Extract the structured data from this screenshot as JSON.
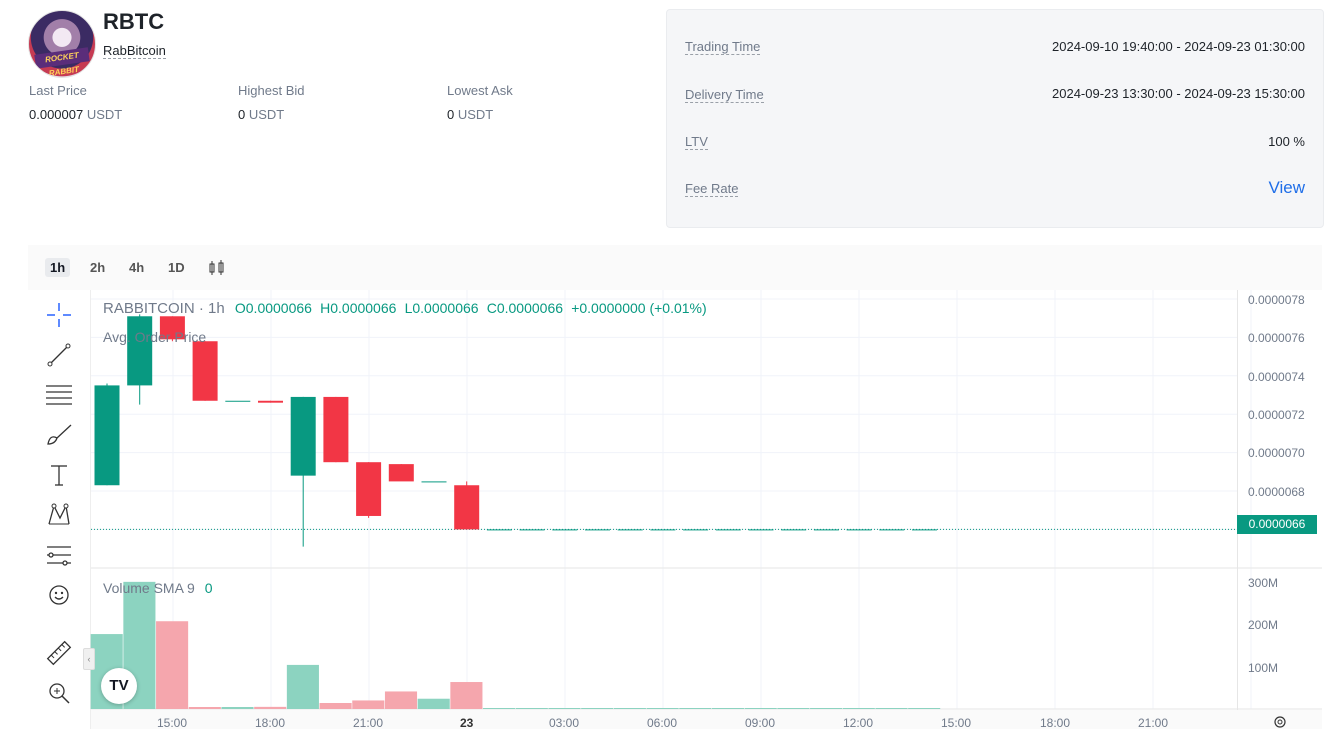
{
  "header": {
    "symbol": "RBTC",
    "name": "RabBitcoin",
    "avatar_text": "ROCKET RABBIT"
  },
  "stats": [
    {
      "label": "Last Price",
      "value": "0.000007",
      "unit": "USDT"
    },
    {
      "label": "Highest Bid",
      "value": "0",
      "unit": "USDT"
    },
    {
      "label": "Lowest Ask",
      "value": "0",
      "unit": "USDT"
    }
  ],
  "info": {
    "trading_time_label": "Trading Time",
    "trading_time_value": "2024-09-10 19:40:00 - 2024-09-23 01:30:00",
    "delivery_time_label": "Delivery Time",
    "delivery_time_value": "2024-09-23 13:30:00 - 2024-09-23 15:30:00",
    "ltv_label": "LTV",
    "ltv_value": "100 %",
    "fee_rate_label": "Fee Rate",
    "fee_rate_link": "View"
  },
  "timeframes": [
    "1h",
    "2h",
    "4h",
    "1D"
  ],
  "active_timeframe": "1h",
  "chart": {
    "symbol_label": "RABBITCOIN · 1h",
    "ohlc": {
      "o": "O0.0000066",
      "h": "H0.0000066",
      "l": "L0.0000066",
      "c": "C0.0000066",
      "change": "+0.0000000 (+0.01%)"
    },
    "indicator_label": "Avg. Order Price",
    "volume_label": "Volume SMA 9",
    "volume_value": "0",
    "last_price_tag": "0.0000066",
    "colors": {
      "up": "#089981",
      "down": "#f23645",
      "up_vol": "#8cd3c0",
      "down_vol": "#f5a6ad"
    }
  },
  "chart_data": {
    "type": "candlestick",
    "y_axis_ticks": [
      "0.0000078",
      "0.0000076",
      "0.0000074",
      "0.0000072",
      "0.0000070",
      "0.0000068"
    ],
    "volume_axis_ticks": [
      "300M",
      "200M",
      "100M"
    ],
    "x_axis_ticks": [
      "15:00",
      "18:00",
      "21:00",
      "23",
      "03:00",
      "06:00",
      "09:00",
      "12:00",
      "15:00",
      "18:00",
      "21:00"
    ],
    "candles": [
      {
        "o": 6.83e-06,
        "h": 7.36e-06,
        "l": 6.83e-06,
        "c": 7.35e-06,
        "v": 175000000
      },
      {
        "o": 7.35e-06,
        "h": 7.72e-06,
        "l": 7.25e-06,
        "c": 7.71e-06,
        "v": 297000000
      },
      {
        "o": 7.71e-06,
        "h": 7.71e-06,
        "l": 7.58e-06,
        "c": 7.59e-06,
        "v": 205000000
      },
      {
        "o": 7.58e-06,
        "h": 7.58e-06,
        "l": 7.27e-06,
        "c": 7.27e-06,
        "v": 2000000
      },
      {
        "o": 7.27e-06,
        "h": 7.27e-06,
        "l": 7.27e-06,
        "c": 7.27e-06,
        "v": 1000000
      },
      {
        "o": 7.27e-06,
        "h": 7.27e-06,
        "l": 7.26e-06,
        "c": 7.26e-06,
        "v": 5000000
      },
      {
        "o": 6.88e-06,
        "h": 7.29e-06,
        "l": 6.51e-06,
        "c": 7.29e-06,
        "v": 103000000
      },
      {
        "o": 7.29e-06,
        "h": 7.29e-06,
        "l": 6.95e-06,
        "c": 6.95e-06,
        "v": 14000000
      },
      {
        "o": 6.95e-06,
        "h": 6.95e-06,
        "l": 6.66e-06,
        "c": 6.67e-06,
        "v": 20000000
      },
      {
        "o": 6.94e-06,
        "h": 6.94e-06,
        "l": 6.86e-06,
        "c": 6.85e-06,
        "v": 41000000
      },
      {
        "o": 6.85e-06,
        "h": 6.85e-06,
        "l": 6.85e-06,
        "c": 6.85e-06,
        "v": 24000000
      },
      {
        "o": 6.83e-06,
        "h": 6.85e-06,
        "l": 6.6e-06,
        "c": 6.6e-06,
        "v": 63000000
      },
      {
        "o": 6.6e-06,
        "h": 6.6e-06,
        "l": 6.6e-06,
        "c": 6.6e-06,
        "v": 0
      },
      {
        "o": 6.6e-06,
        "h": 6.6e-06,
        "l": 6.6e-06,
        "c": 6.6e-06,
        "v": 0
      },
      {
        "o": 6.6e-06,
        "h": 6.6e-06,
        "l": 6.6e-06,
        "c": 6.6e-06,
        "v": 0
      },
      {
        "o": 6.6e-06,
        "h": 6.6e-06,
        "l": 6.6e-06,
        "c": 6.6e-06,
        "v": 0
      },
      {
        "o": 6.6e-06,
        "h": 6.6e-06,
        "l": 6.6e-06,
        "c": 6.6e-06,
        "v": 0
      },
      {
        "o": 6.6e-06,
        "h": 6.6e-06,
        "l": 6.6e-06,
        "c": 6.6e-06,
        "v": 0
      },
      {
        "o": 6.6e-06,
        "h": 6.6e-06,
        "l": 6.6e-06,
        "c": 6.6e-06,
        "v": 0
      },
      {
        "o": 6.6e-06,
        "h": 6.6e-06,
        "l": 6.6e-06,
        "c": 6.6e-06,
        "v": 0
      },
      {
        "o": 6.6e-06,
        "h": 6.6e-06,
        "l": 6.6e-06,
        "c": 6.6e-06,
        "v": 0
      },
      {
        "o": 6.6e-06,
        "h": 6.6e-06,
        "l": 6.6e-06,
        "c": 6.6e-06,
        "v": 0
      },
      {
        "o": 6.6e-06,
        "h": 6.6e-06,
        "l": 6.6e-06,
        "c": 6.6e-06,
        "v": 0
      },
      {
        "o": 6.6e-06,
        "h": 6.6e-06,
        "l": 6.6e-06,
        "c": 6.6e-06,
        "v": 0
      },
      {
        "o": 6.6e-06,
        "h": 6.6e-06,
        "l": 6.6e-06,
        "c": 6.6e-06,
        "v": 0
      },
      {
        "o": 6.6e-06,
        "h": 6.6e-06,
        "l": 6.6e-06,
        "c": 6.6e-06,
        "v": 0
      }
    ],
    "price_range": [
      6.4e-06,
      7.9e-06
    ],
    "volume_range": [
      0,
      320000000
    ],
    "last_price": 6.6e-06,
    "grid": true
  },
  "tools": [
    "crosshair-icon",
    "trendline-icon",
    "fib-levels-icon",
    "brush-icon",
    "text-icon",
    "pattern-icon",
    "forecast-icon",
    "emoji-icon",
    "ruler-icon",
    "zoom-in-icon"
  ]
}
